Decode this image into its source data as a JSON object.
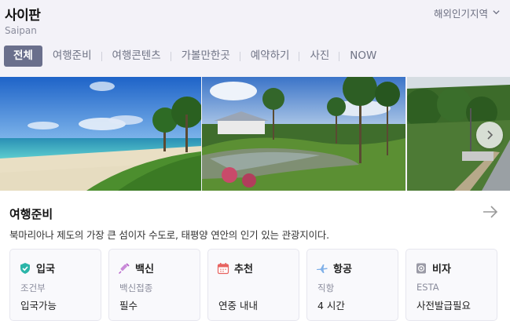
{
  "header": {
    "title": "사이판",
    "subtitle": "Saipan",
    "region_label": "해외인기지역"
  },
  "tabs": [
    {
      "label": "전체",
      "active": true
    },
    {
      "label": "여행준비"
    },
    {
      "label": "여행콘텐츠"
    },
    {
      "label": "가볼만한곳"
    },
    {
      "label": "예약하기"
    },
    {
      "label": "사진"
    },
    {
      "label": "NOW"
    }
  ],
  "section": {
    "title": "여행준비",
    "description": "북마리아나 제도의 가장 큰 섬이자 수도로, 태평양 연안의 인기 있는 관광지이다.",
    "cards": [
      {
        "icon": "shield-check-icon",
        "label": "입국",
        "sub": "조건부",
        "value": "입국가능",
        "color": "#2bb5a9"
      },
      {
        "icon": "syringe-icon",
        "label": "백신",
        "sub": "백신접종",
        "value": "필수",
        "color": "#b561c9"
      },
      {
        "icon": "calendar-icon",
        "label": "추천",
        "sub": "",
        "value": "연중 내내",
        "color": "#e7625f"
      },
      {
        "icon": "airplane-icon",
        "label": "항공",
        "sub": "직항",
        "value": "4 시간",
        "color": "#7fb0e8"
      },
      {
        "icon": "visa-icon",
        "label": "비자",
        "sub": "ESTA",
        "value": "사전발급필요",
        "color": "#9a9aa6"
      }
    ]
  },
  "colors": {
    "active_tab": "#6a6f8c",
    "background": "#f3f2f8"
  }
}
